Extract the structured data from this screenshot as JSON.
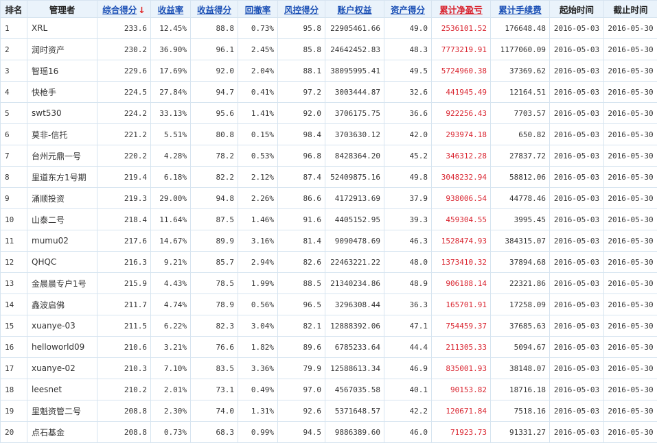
{
  "headers": {
    "rank": "排名",
    "manager": "管理者",
    "total_score": "综合得分",
    "sort_arrow": "↓",
    "return_rate": "收益率",
    "return_score": "收益得分",
    "drawdown": "回撤率",
    "risk_score": "风控得分",
    "equity": "账户权益",
    "asset_score": "资产得分",
    "cum_pnl": "累计净盈亏",
    "cum_fee": "累计手续费",
    "start": "起始时间",
    "end": "截止时间"
  },
  "colors": {
    "header_bg": "#eaf3fb",
    "link_blue": "#1a4fb5",
    "profit_red": "#d9232e",
    "border": "#d6e4f0"
  },
  "rows": [
    [
      "1",
      "XRL",
      "233.6",
      "12.45%",
      "88.8",
      "0.73%",
      "95.8",
      "22905461.66",
      "49.0",
      "2536101.52",
      "176648.48",
      "2016-05-03",
      "2016-05-30"
    ],
    [
      "2",
      "润时资产",
      "230.2",
      "36.90%",
      "96.1",
      "2.45%",
      "85.8",
      "24642452.83",
      "48.3",
      "7773219.91",
      "1177060.09",
      "2016-05-03",
      "2016-05-30"
    ],
    [
      "3",
      "智瑶16",
      "229.6",
      "17.69%",
      "92.0",
      "2.04%",
      "88.1",
      "38095995.41",
      "49.5",
      "5724960.38",
      "37369.62",
      "2016-05-03",
      "2016-05-30"
    ],
    [
      "4",
      "快枪手",
      "224.5",
      "27.84%",
      "94.7",
      "0.41%",
      "97.2",
      "3003444.87",
      "32.6",
      "441945.49",
      "12164.51",
      "2016-05-03",
      "2016-05-30"
    ],
    [
      "5",
      "swt530",
      "224.2",
      "33.13%",
      "95.6",
      "1.41%",
      "92.0",
      "3706175.75",
      "36.6",
      "922256.43",
      "7703.57",
      "2016-05-03",
      "2016-05-30"
    ],
    [
      "6",
      "莫非-信托",
      "221.2",
      "5.51%",
      "80.8",
      "0.15%",
      "98.4",
      "3703630.12",
      "42.0",
      "293974.18",
      "650.82",
      "2016-05-03",
      "2016-05-30"
    ],
    [
      "7",
      "台州元鼎一号",
      "220.2",
      "4.28%",
      "78.2",
      "0.53%",
      "96.8",
      "8428364.20",
      "45.2",
      "346312.28",
      "27837.72",
      "2016-05-03",
      "2016-05-30"
    ],
    [
      "8",
      "里道东方1号期",
      "219.4",
      "6.18%",
      "82.2",
      "2.12%",
      "87.4",
      "52409875.16",
      "49.8",
      "3048232.94",
      "58812.06",
      "2016-05-03",
      "2016-05-30"
    ],
    [
      "9",
      "涌顺投资",
      "219.3",
      "29.00%",
      "94.8",
      "2.26%",
      "86.6",
      "4172913.69",
      "37.9",
      "938006.54",
      "44778.46",
      "2016-05-03",
      "2016-05-30"
    ],
    [
      "10",
      "山泰二号",
      "218.4",
      "11.64%",
      "87.5",
      "1.46%",
      "91.6",
      "4405152.95",
      "39.3",
      "459304.55",
      "3995.45",
      "2016-05-03",
      "2016-05-30"
    ],
    [
      "11",
      "mumu02",
      "217.6",
      "14.67%",
      "89.9",
      "3.16%",
      "81.4",
      "9090478.69",
      "46.3",
      "1528474.93",
      "384315.07",
      "2016-05-03",
      "2016-05-30"
    ],
    [
      "12",
      "QHQC",
      "216.3",
      "9.21%",
      "85.7",
      "2.94%",
      "82.6",
      "22463221.22",
      "48.0",
      "1373410.32",
      "37894.68",
      "2016-05-03",
      "2016-05-30"
    ],
    [
      "13",
      "金晨晨专户1号",
      "215.9",
      "4.43%",
      "78.5",
      "1.99%",
      "88.5",
      "21340234.86",
      "48.9",
      "906188.14",
      "22321.86",
      "2016-05-03",
      "2016-05-30"
    ],
    [
      "14",
      "鑫波启佛",
      "211.7",
      "4.74%",
      "78.9",
      "0.56%",
      "96.5",
      "3296308.44",
      "36.3",
      "165701.91",
      "17258.09",
      "2016-05-03",
      "2016-05-30"
    ],
    [
      "15",
      "xuanye-03",
      "211.5",
      "6.22%",
      "82.3",
      "3.04%",
      "82.1",
      "12888392.06",
      "47.1",
      "754459.37",
      "37685.63",
      "2016-05-03",
      "2016-05-30"
    ],
    [
      "16",
      "helloworld09",
      "210.6",
      "3.21%",
      "76.6",
      "1.82%",
      "89.6",
      "6785233.64",
      "44.4",
      "211305.33",
      "5094.67",
      "2016-05-03",
      "2016-05-30"
    ],
    [
      "17",
      "xuanye-02",
      "210.3",
      "7.10%",
      "83.5",
      "3.36%",
      "79.9",
      "12588613.34",
      "46.9",
      "835001.93",
      "38148.07",
      "2016-05-03",
      "2016-05-30"
    ],
    [
      "18",
      "leesnet",
      "210.2",
      "2.01%",
      "73.1",
      "0.49%",
      "97.0",
      "4567035.58",
      "40.1",
      "90153.82",
      "18716.18",
      "2016-05-03",
      "2016-05-30"
    ],
    [
      "19",
      "里魁资管二号",
      "208.8",
      "2.30%",
      "74.0",
      "1.31%",
      "92.6",
      "5371648.57",
      "42.2",
      "120671.84",
      "7518.16",
      "2016-05-03",
      "2016-05-30"
    ],
    [
      "20",
      "点石基金",
      "208.8",
      "0.73%",
      "68.3",
      "0.99%",
      "94.5",
      "9886389.60",
      "46.0",
      "71923.73",
      "91331.27",
      "2016-05-03",
      "2016-05-30"
    ]
  ]
}
